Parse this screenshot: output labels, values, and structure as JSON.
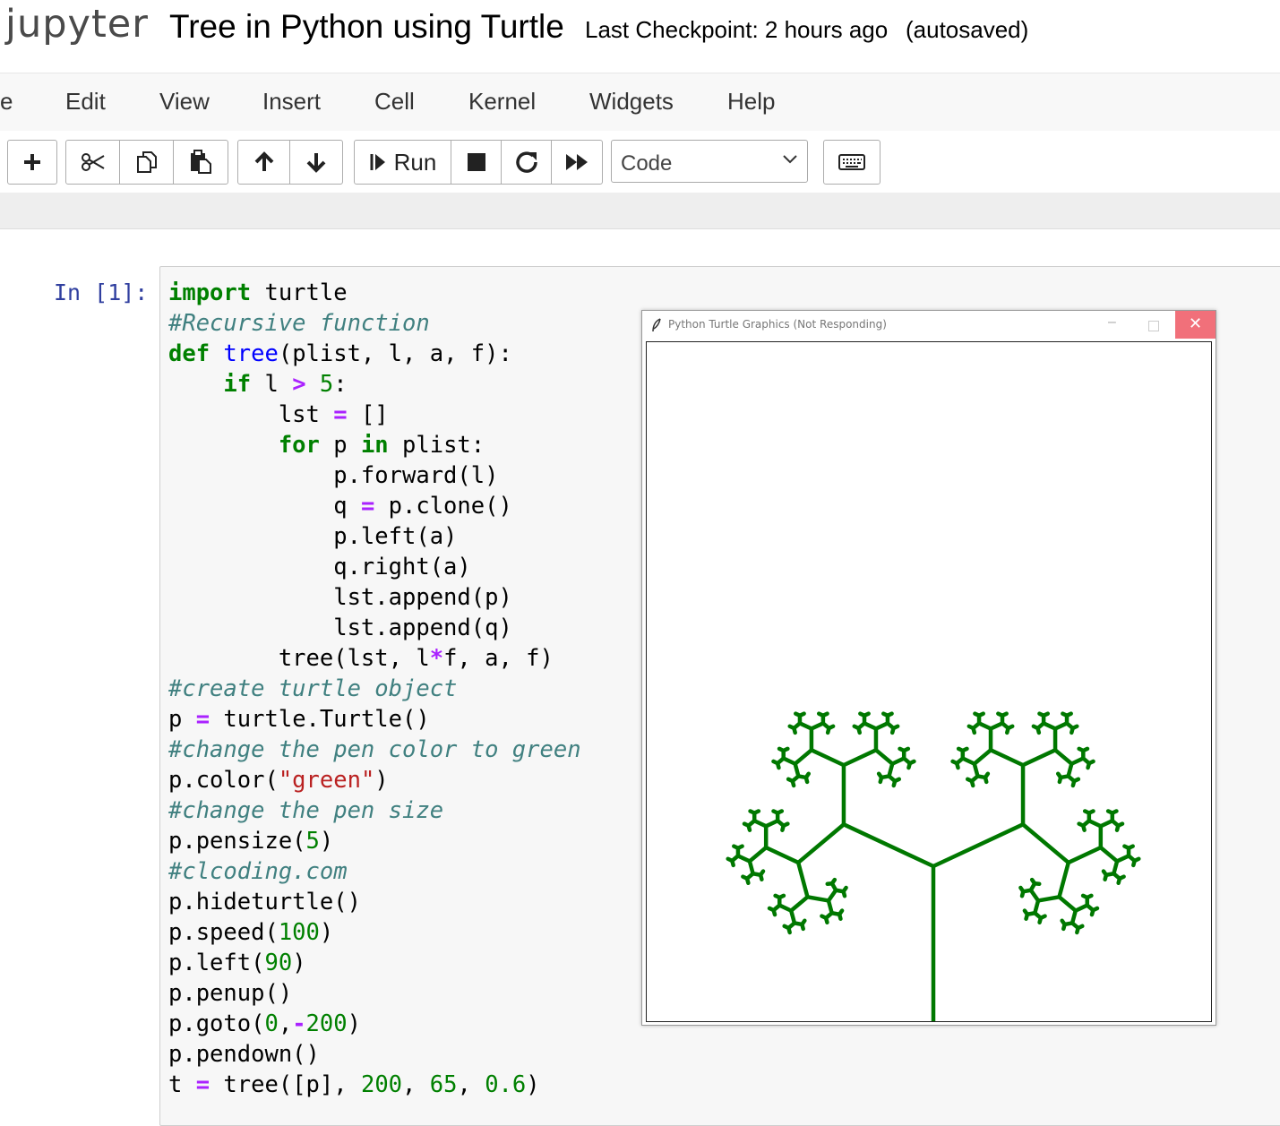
{
  "header": {
    "logo": "jupyter",
    "notebook_title": "Tree in Python using Turtle",
    "checkpoint": "Last Checkpoint: 2 hours ago",
    "autosave": "(autosaved)"
  },
  "menubar": {
    "items": [
      "e",
      "Edit",
      "View",
      "Insert",
      "Cell",
      "Kernel",
      "Widgets",
      "Help"
    ]
  },
  "toolbar": {
    "buttons": {
      "add": "plus-icon",
      "cut": "scissors-icon",
      "copy": "copy-icon",
      "paste": "paste-icon",
      "move_up": "arrow-up-icon",
      "move_down": "arrow-down-icon",
      "run_label": "Run",
      "interrupt": "stop-icon",
      "restart": "restart-icon",
      "restart_run_all": "fast-forward-icon",
      "command_palette": "keyboard-icon"
    },
    "cell_type": "Code"
  },
  "cell": {
    "prompt": "In [1]:",
    "lines": [
      [
        {
          "t": "import",
          "c": "kw"
        },
        {
          "t": " turtle",
          "c": ""
        }
      ],
      [
        {
          "t": "#Recursive function",
          "c": "cm"
        }
      ],
      [
        {
          "t": "def",
          "c": "kw"
        },
        {
          "t": " ",
          "c": ""
        },
        {
          "t": "tree",
          "c": "fn"
        },
        {
          "t": "(plist, l, a, f):",
          "c": ""
        }
      ],
      [
        {
          "t": "    ",
          "c": ""
        },
        {
          "t": "if",
          "c": "kw"
        },
        {
          "t": " l ",
          "c": ""
        },
        {
          "t": ">",
          "c": "op"
        },
        {
          "t": " ",
          "c": ""
        },
        {
          "t": "5",
          "c": "num"
        },
        {
          "t": ":",
          "c": ""
        }
      ],
      [
        {
          "t": "        lst ",
          "c": ""
        },
        {
          "t": "=",
          "c": "op"
        },
        {
          "t": " []",
          "c": ""
        }
      ],
      [
        {
          "t": "        ",
          "c": ""
        },
        {
          "t": "for",
          "c": "kw"
        },
        {
          "t": " p ",
          "c": ""
        },
        {
          "t": "in",
          "c": "kw"
        },
        {
          "t": " plist:",
          "c": ""
        }
      ],
      [
        {
          "t": "            p.forward(l)",
          "c": ""
        }
      ],
      [
        {
          "t": "            q ",
          "c": ""
        },
        {
          "t": "=",
          "c": "op"
        },
        {
          "t": " p.clone()",
          "c": ""
        }
      ],
      [
        {
          "t": "            p.left(a)",
          "c": ""
        }
      ],
      [
        {
          "t": "            q.right(a)",
          "c": ""
        }
      ],
      [
        {
          "t": "            lst.append(p)",
          "c": ""
        }
      ],
      [
        {
          "t": "            lst.append(q)",
          "c": ""
        }
      ],
      [
        {
          "t": "        tree(lst, l",
          "c": ""
        },
        {
          "t": "*",
          "c": "op"
        },
        {
          "t": "f, a, f)",
          "c": ""
        }
      ],
      [
        {
          "t": "#create turtle object",
          "c": "cm"
        }
      ],
      [
        {
          "t": "p ",
          "c": ""
        },
        {
          "t": "=",
          "c": "op"
        },
        {
          "t": " turtle.Turtle()",
          "c": ""
        }
      ],
      [
        {
          "t": "#change the pen color to green",
          "c": "cm"
        }
      ],
      [
        {
          "t": "p.color(",
          "c": ""
        },
        {
          "t": "\"green\"",
          "c": "str"
        },
        {
          "t": ")",
          "c": ""
        }
      ],
      [
        {
          "t": "#change the pen size",
          "c": "cm"
        }
      ],
      [
        {
          "t": "p.pensize(",
          "c": ""
        },
        {
          "t": "5",
          "c": "num"
        },
        {
          "t": ")",
          "c": ""
        }
      ],
      [
        {
          "t": "#clcoding.com",
          "c": "cm"
        }
      ],
      [
        {
          "t": "p.hideturtle()",
          "c": ""
        }
      ],
      [
        {
          "t": "p.speed(",
          "c": ""
        },
        {
          "t": "100",
          "c": "num"
        },
        {
          "t": ")",
          "c": ""
        }
      ],
      [
        {
          "t": "p.left(",
          "c": ""
        },
        {
          "t": "90",
          "c": "num"
        },
        {
          "t": ")",
          "c": ""
        }
      ],
      [
        {
          "t": "p.penup()",
          "c": ""
        }
      ],
      [
        {
          "t": "p.goto(",
          "c": ""
        },
        {
          "t": "0",
          "c": "num"
        },
        {
          "t": ",",
          "c": ""
        },
        {
          "t": "-",
          "c": "op"
        },
        {
          "t": "200",
          "c": "num"
        },
        {
          "t": ")",
          "c": ""
        }
      ],
      [
        {
          "t": "p.pendown()",
          "c": ""
        }
      ],
      [
        {
          "t": "t ",
          "c": ""
        },
        {
          "t": "=",
          "c": "op"
        },
        {
          "t": " tree([p], ",
          "c": ""
        },
        {
          "t": "200",
          "c": "num"
        },
        {
          "t": ", ",
          "c": ""
        },
        {
          "t": "65",
          "c": "num"
        },
        {
          "t": ", ",
          "c": ""
        },
        {
          "t": "0.6",
          "c": "num"
        },
        {
          "t": ")",
          "c": ""
        }
      ]
    ]
  },
  "turtle_window": {
    "title": "Python Turtle Graphics (Not Responding)",
    "minimize": "–",
    "close": "✕",
    "pen_color": "#007800",
    "tree": {
      "length": 200,
      "angle": 65,
      "factor": 0.6,
      "min_length": 5
    }
  }
}
